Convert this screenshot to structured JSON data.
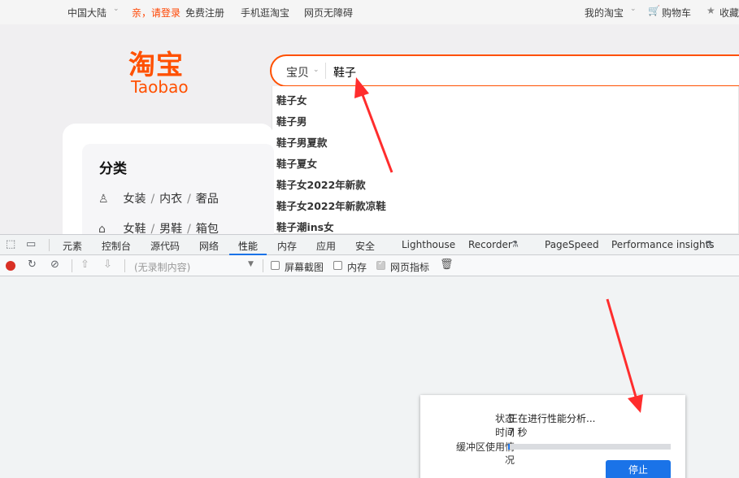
{
  "topbar": {
    "region": "中国大陆",
    "login_link": "亲，请登录",
    "register_link": "免费注册",
    "mobile_link": "手机逛淘宝",
    "accessibility_link": "网页无障碍",
    "my_taobao": "我的淘宝",
    "cart": "购物车",
    "favorites": "收藏",
    "caret": "⌄"
  },
  "logo": {
    "chinese": "淘宝",
    "english": "Taobao"
  },
  "search": {
    "type": "宝贝",
    "query": "鞋子",
    "suggestions": [
      "鞋子女",
      "鞋子男",
      "鞋子男夏款",
      "鞋子夏女",
      "鞋子女2022年新款",
      "鞋子女2022年新款凉鞋",
      "鞋子潮ins女"
    ]
  },
  "category": {
    "title": "分类",
    "rows": [
      {
        "icon": "dress-icon",
        "items": [
          "女装",
          "内衣",
          "奢品"
        ]
      },
      {
        "icon": "shoe-icon",
        "items": [
          "女鞋",
          "男鞋",
          "箱包"
        ]
      }
    ]
  },
  "devtools": {
    "tabs": [
      "元素",
      "控制台",
      "源代码",
      "网络",
      "性能",
      "内存",
      "应用",
      "安全",
      "Lighthouse",
      "Recorder",
      "PageSpeed",
      "Performance insights"
    ],
    "active_tab": "性能",
    "recording_select": "(无录制内容)",
    "options": [
      {
        "label": "屏幕截图",
        "checked": false
      },
      {
        "label": "内存",
        "checked": false
      },
      {
        "label": "网页指标",
        "checked": true
      }
    ],
    "status_dialog": {
      "status_label": "状态",
      "status_value": "正在进行性能分析...",
      "time_label": "时间",
      "time_value": "7 秒",
      "buffer_label_1": "缓冲区使用情",
      "buffer_label_2": "况",
      "buffer_usage": 0.01,
      "stop_button": "停止"
    }
  },
  "colors": {
    "brand": "#ff5000",
    "devtools_accent": "#1a73e8",
    "annotation_arrow": "#ff2d2d"
  }
}
